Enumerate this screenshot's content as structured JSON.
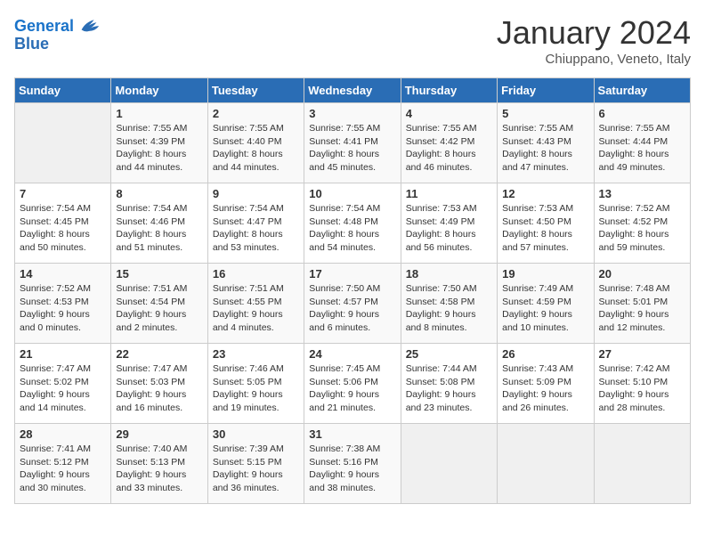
{
  "header": {
    "logo_general": "General",
    "logo_blue": "Blue",
    "month": "January 2024",
    "location": "Chiuppano, Veneto, Italy"
  },
  "days_of_week": [
    "Sunday",
    "Monday",
    "Tuesday",
    "Wednesday",
    "Thursday",
    "Friday",
    "Saturday"
  ],
  "weeks": [
    [
      {
        "day": "",
        "empty": true
      },
      {
        "day": "1",
        "sunrise": "7:55 AM",
        "sunset": "4:39 PM",
        "daylight": "8 hours and 44 minutes."
      },
      {
        "day": "2",
        "sunrise": "7:55 AM",
        "sunset": "4:40 PM",
        "daylight": "8 hours and 44 minutes."
      },
      {
        "day": "3",
        "sunrise": "7:55 AM",
        "sunset": "4:41 PM",
        "daylight": "8 hours and 45 minutes."
      },
      {
        "day": "4",
        "sunrise": "7:55 AM",
        "sunset": "4:42 PM",
        "daylight": "8 hours and 46 minutes."
      },
      {
        "day": "5",
        "sunrise": "7:55 AM",
        "sunset": "4:43 PM",
        "daylight": "8 hours and 47 minutes."
      },
      {
        "day": "6",
        "sunrise": "7:55 AM",
        "sunset": "4:44 PM",
        "daylight": "8 hours and 49 minutes."
      }
    ],
    [
      {
        "day": "7",
        "sunrise": "7:54 AM",
        "sunset": "4:45 PM",
        "daylight": "8 hours and 50 minutes."
      },
      {
        "day": "8",
        "sunrise": "7:54 AM",
        "sunset": "4:46 PM",
        "daylight": "8 hours and 51 minutes."
      },
      {
        "day": "9",
        "sunrise": "7:54 AM",
        "sunset": "4:47 PM",
        "daylight": "8 hours and 53 minutes."
      },
      {
        "day": "10",
        "sunrise": "7:54 AM",
        "sunset": "4:48 PM",
        "daylight": "8 hours and 54 minutes."
      },
      {
        "day": "11",
        "sunrise": "7:53 AM",
        "sunset": "4:49 PM",
        "daylight": "8 hours and 56 minutes."
      },
      {
        "day": "12",
        "sunrise": "7:53 AM",
        "sunset": "4:50 PM",
        "daylight": "8 hours and 57 minutes."
      },
      {
        "day": "13",
        "sunrise": "7:52 AM",
        "sunset": "4:52 PM",
        "daylight": "8 hours and 59 minutes."
      }
    ],
    [
      {
        "day": "14",
        "sunrise": "7:52 AM",
        "sunset": "4:53 PM",
        "daylight": "9 hours and 0 minutes."
      },
      {
        "day": "15",
        "sunrise": "7:51 AM",
        "sunset": "4:54 PM",
        "daylight": "9 hours and 2 minutes."
      },
      {
        "day": "16",
        "sunrise": "7:51 AM",
        "sunset": "4:55 PM",
        "daylight": "9 hours and 4 minutes."
      },
      {
        "day": "17",
        "sunrise": "7:50 AM",
        "sunset": "4:57 PM",
        "daylight": "9 hours and 6 minutes."
      },
      {
        "day": "18",
        "sunrise": "7:50 AM",
        "sunset": "4:58 PM",
        "daylight": "9 hours and 8 minutes."
      },
      {
        "day": "19",
        "sunrise": "7:49 AM",
        "sunset": "4:59 PM",
        "daylight": "9 hours and 10 minutes."
      },
      {
        "day": "20",
        "sunrise": "7:48 AM",
        "sunset": "5:01 PM",
        "daylight": "9 hours and 12 minutes."
      }
    ],
    [
      {
        "day": "21",
        "sunrise": "7:47 AM",
        "sunset": "5:02 PM",
        "daylight": "9 hours and 14 minutes."
      },
      {
        "day": "22",
        "sunrise": "7:47 AM",
        "sunset": "5:03 PM",
        "daylight": "9 hours and 16 minutes."
      },
      {
        "day": "23",
        "sunrise": "7:46 AM",
        "sunset": "5:05 PM",
        "daylight": "9 hours and 19 minutes."
      },
      {
        "day": "24",
        "sunrise": "7:45 AM",
        "sunset": "5:06 PM",
        "daylight": "9 hours and 21 minutes."
      },
      {
        "day": "25",
        "sunrise": "7:44 AM",
        "sunset": "5:08 PM",
        "daylight": "9 hours and 23 minutes."
      },
      {
        "day": "26",
        "sunrise": "7:43 AM",
        "sunset": "5:09 PM",
        "daylight": "9 hours and 26 minutes."
      },
      {
        "day": "27",
        "sunrise": "7:42 AM",
        "sunset": "5:10 PM",
        "daylight": "9 hours and 28 minutes."
      }
    ],
    [
      {
        "day": "28",
        "sunrise": "7:41 AM",
        "sunset": "5:12 PM",
        "daylight": "9 hours and 30 minutes."
      },
      {
        "day": "29",
        "sunrise": "7:40 AM",
        "sunset": "5:13 PM",
        "daylight": "9 hours and 33 minutes."
      },
      {
        "day": "30",
        "sunrise": "7:39 AM",
        "sunset": "5:15 PM",
        "daylight": "9 hours and 36 minutes."
      },
      {
        "day": "31",
        "sunrise": "7:38 AM",
        "sunset": "5:16 PM",
        "daylight": "9 hours and 38 minutes."
      },
      {
        "day": "",
        "empty": true
      },
      {
        "day": "",
        "empty": true
      },
      {
        "day": "",
        "empty": true
      }
    ]
  ],
  "labels": {
    "sunrise": "Sunrise:",
    "sunset": "Sunset:",
    "daylight": "Daylight:"
  }
}
